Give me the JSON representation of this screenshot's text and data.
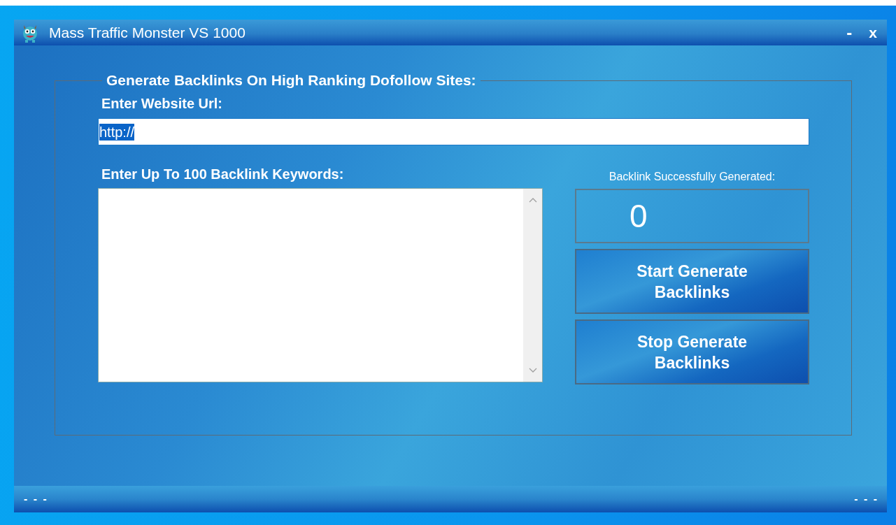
{
  "window": {
    "title": "Mass Traffic Monster VS 1000",
    "controls": [
      {
        "kind": "minimize",
        "label": "-"
      },
      {
        "kind": "close",
        "label": "x"
      }
    ]
  },
  "group": {
    "title": "Generate Backlinks On High Ranking Dofollow Sites:"
  },
  "url_field": {
    "label": "Enter Website Url:",
    "value": "http://",
    "selected": true
  },
  "keywords_field": {
    "label": "Enter Up To 100 Backlink Keywords:"
  },
  "counter": {
    "label": "Backlink Successfully Generated:",
    "value": "0"
  },
  "buttons": [
    "Start Generate Backlinks",
    "Stop Generate Backlinks"
  ],
  "status_bar": {
    "left": "- - -",
    "right": "- - -"
  }
}
